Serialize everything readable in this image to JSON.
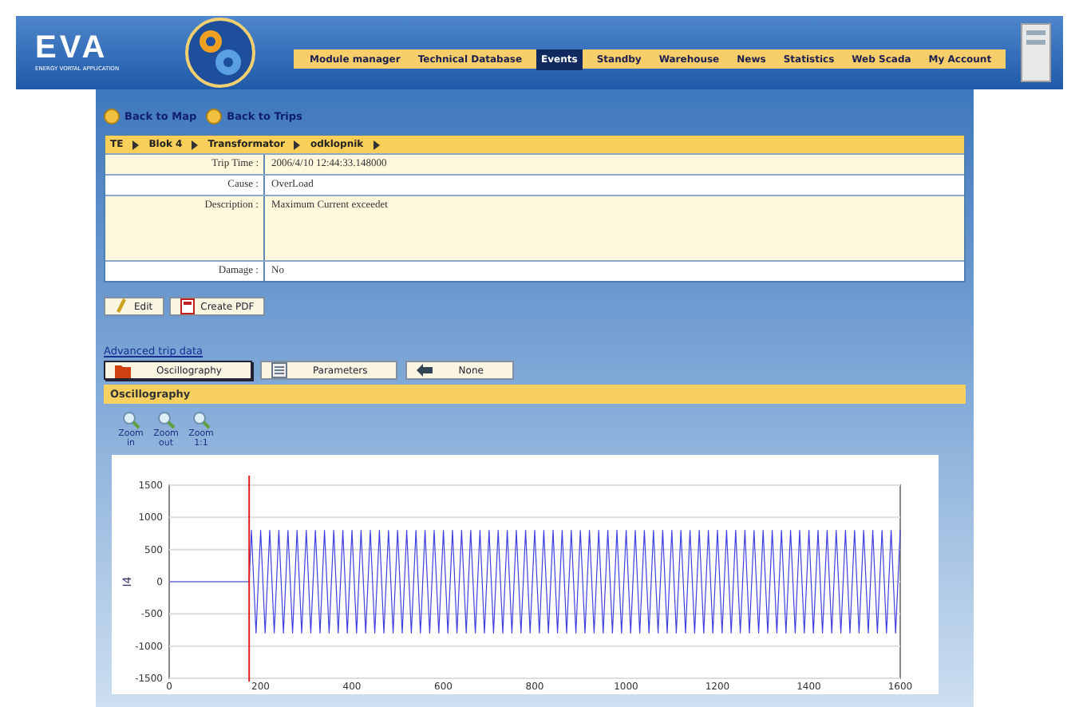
{
  "header": {
    "logo": "EVA",
    "tagline": "ENERGY VORTAL APPLICATION",
    "nav": [
      {
        "label": "Module manager",
        "selected": false
      },
      {
        "label": "Technical Database",
        "selected": false
      },
      {
        "label": "Events",
        "selected": true
      },
      {
        "label": "Standby",
        "selected": false
      },
      {
        "label": "Warehouse",
        "selected": false
      },
      {
        "label": "News",
        "selected": false
      },
      {
        "label": "Statistics",
        "selected": false
      },
      {
        "label": "Web Scada",
        "selected": false
      },
      {
        "label": "My Account",
        "selected": false
      }
    ]
  },
  "back_links": [
    "Back to Map",
    "Back to Trips"
  ],
  "trip": {
    "breadcrumb": [
      "TE",
      "Blok 4",
      "Transformator",
      "odklopnik"
    ],
    "fields": [
      {
        "label": "Trip Time :",
        "value": "2006/4/10 12:44:33.148000",
        "kind": "line"
      },
      {
        "label": "Cause :",
        "value": "OverLoad",
        "kind": "line"
      },
      {
        "label": "Description :",
        "value": "Maximum Current exceedet",
        "kind": "area"
      },
      {
        "label": "Damage :",
        "value": "No",
        "kind": "line"
      }
    ]
  },
  "actions": [
    {
      "label": "Edit",
      "kind": "edit"
    },
    {
      "label": "Create PDF",
      "kind": "pdf"
    }
  ],
  "advanced_link": "Advanced trip data",
  "data_tabs": [
    {
      "label": "Oscillography",
      "kind": "folder",
      "selected": true
    },
    {
      "label": "Parameters",
      "kind": "sheet",
      "selected": false
    },
    {
      "label": "None",
      "kind": "back",
      "selected": false
    }
  ],
  "section_title": "Oscillography",
  "zoom_buttons": [
    "Zoom in",
    "Zoom out",
    "Zoom 1:1"
  ],
  "chart_data": {
    "type": "line",
    "xlim": [
      0,
      1600
    ],
    "ylim": [
      -1500,
      1500
    ],
    "xticks": [
      0,
      200,
      400,
      600,
      800,
      1000,
      1200,
      1400,
      1600
    ],
    "yticks": [
      -1500,
      -1000,
      -500,
      0,
      500,
      1000,
      1500
    ],
    "grid": true,
    "ref_lines": [
      {
        "axis": "x",
        "value": 175,
        "color": "#e02020"
      }
    ],
    "x": [
      0,
      175,
      180,
      190,
      200,
      210,
      220,
      230,
      240,
      250,
      260,
      270,
      280,
      290,
      300,
      310,
      320,
      330,
      340,
      350,
      360,
      370,
      380,
      390,
      400,
      410,
      420,
      430,
      440,
      450,
      460,
      470,
      480,
      490,
      500,
      510,
      520,
      530,
      540,
      550,
      560,
      570,
      580,
      590,
      600,
      610,
      620,
      630,
      640,
      650,
      660,
      670,
      680,
      690,
      700,
      710,
      720,
      730,
      740,
      750,
      760,
      770,
      780,
      790,
      800,
      810,
      820,
      830,
      840,
      850,
      860,
      870,
      880,
      890,
      900,
      910,
      920,
      930,
      940,
      950,
      960,
      970,
      980,
      990,
      1000,
      1010,
      1020,
      1030,
      1040,
      1050,
      1060,
      1070,
      1080,
      1090,
      1100,
      1110,
      1120,
      1130,
      1140,
      1150,
      1160,
      1170,
      1180,
      1190,
      1200,
      1210,
      1220,
      1230,
      1240,
      1250,
      1260,
      1270,
      1280,
      1290,
      1300,
      1310,
      1320,
      1330,
      1340,
      1350,
      1360,
      1370,
      1380,
      1390,
      1400,
      1410,
      1420,
      1430,
      1440,
      1450,
      1460,
      1470,
      1480,
      1490,
      1500,
      1510,
      1520,
      1530,
      1540,
      1550,
      1560,
      1570,
      1580,
      1590,
      1600
    ],
    "series": [
      {
        "name": "I4",
        "color": "#4040e0",
        "values": [
          0,
          0,
          800,
          -800,
          800,
          -800,
          800,
          -800,
          800,
          -800,
          800,
          -800,
          800,
          -800,
          800,
          -800,
          800,
          -800,
          800,
          -800,
          800,
          -800,
          800,
          -800,
          800,
          -800,
          800,
          -800,
          800,
          -800,
          800,
          -800,
          800,
          -800,
          800,
          -800,
          800,
          -800,
          800,
          -800,
          800,
          -800,
          800,
          -800,
          800,
          -800,
          800,
          -800,
          800,
          -800,
          800,
          -800,
          800,
          -800,
          800,
          -800,
          800,
          -800,
          800,
          -800,
          800,
          -800,
          800,
          -800,
          800,
          -800,
          800,
          -800,
          800,
          -800,
          800,
          -800,
          800,
          -800,
          800,
          -800,
          800,
          -800,
          800,
          -800,
          800,
          -800,
          800,
          -800,
          800,
          -800,
          800,
          -800,
          800,
          -800,
          800,
          -800,
          800,
          -800,
          800,
          -800,
          800,
          -800,
          800,
          -800,
          800,
          -800,
          800,
          -800,
          800,
          -800,
          800,
          -800,
          800,
          -800,
          800,
          -800,
          800,
          -800,
          800,
          -800,
          800,
          -800,
          800,
          -800,
          800,
          -800,
          800,
          -800,
          800,
          -800,
          800,
          -800,
          800,
          -800,
          800,
          -800,
          800,
          -800,
          800,
          -800,
          800,
          -800,
          800,
          -800,
          800,
          -800,
          800,
          -800,
          800
        ]
      }
    ]
  }
}
